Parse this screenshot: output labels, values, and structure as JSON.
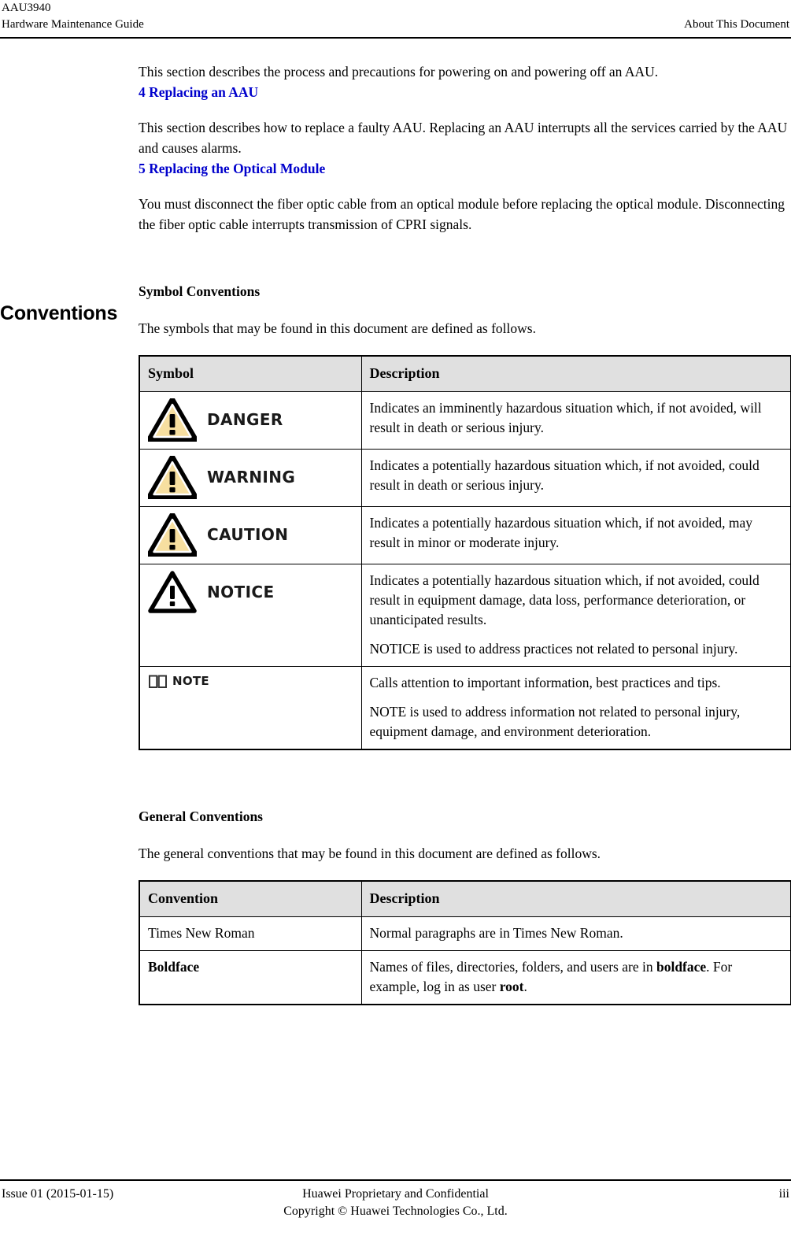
{
  "header": {
    "doc_id": "AAU3940",
    "guide_title": "Hardware Maintenance Guide",
    "section_name": "About This Document"
  },
  "body": {
    "intro_paragraph": "This section describes the process and precautions for powering on and powering off an AAU.",
    "links": [
      {
        "label": "4 Replacing an AAU",
        "description": "This section describes how to replace a faulty AAU. Replacing an AAU interrupts all the services carried by the AAU and causes alarms.",
        "color": "#0000CC"
      },
      {
        "label": "5 Replacing the Optical Module",
        "description": "You must disconnect the fiber optic cable from an optical module before replacing the optical module. Disconnecting the fiber optic cable interrupts transmission of CPRI signals.",
        "color": "#0000CC"
      }
    ],
    "conventions_heading": "Conventions",
    "symbol_conventions": {
      "heading": "Symbol Conventions",
      "intro": "The symbols that may be found in this document are defined as follows.",
      "columns": [
        "Symbol",
        "Description"
      ],
      "rows": [
        {
          "icon": "danger-triangle-icon",
          "icon_label": "DANGER",
          "icon_style": "filled-amber-triangle",
          "paragraphs": [
            "Indicates an imminently hazardous situation which, if not avoided, will result in death or serious injury."
          ]
        },
        {
          "icon": "warning-triangle-icon",
          "icon_label": "WARNING",
          "icon_style": "filled-amber-triangle",
          "paragraphs": [
            "Indicates a potentially hazardous situation which, if not avoided, could result in death or serious injury."
          ]
        },
        {
          "icon": "caution-triangle-icon",
          "icon_label": "CAUTION",
          "icon_style": "filled-amber-triangle",
          "paragraphs": [
            "Indicates a potentially hazardous situation which, if not avoided, may result in minor or moderate injury."
          ]
        },
        {
          "icon": "notice-triangle-icon",
          "icon_label": "NOTICE",
          "icon_style": "outline-triangle",
          "paragraphs": [
            "Indicates a potentially hazardous situation which, if not avoided, could result in equipment damage, data loss, performance deterioration, or unanticipated results.",
            "NOTICE is used to address practices not related to personal injury."
          ]
        },
        {
          "icon": "note-book-icon",
          "icon_label": "NOTE",
          "icon_style": "open-book",
          "paragraphs": [
            "Calls attention to important information, best practices and tips.",
            "NOTE is used to address information not related to personal injury, equipment damage, and environment deterioration."
          ]
        }
      ]
    },
    "general_conventions": {
      "heading": "General Conventions",
      "intro": "The general conventions that may be found in this document are defined as follows.",
      "columns": [
        "Convention",
        "Description"
      ],
      "rows": [
        {
          "convention": "Times New Roman",
          "convention_bold": false,
          "description_html": "Normal paragraphs are in Times New Roman."
        },
        {
          "convention": "Boldface",
          "convention_bold": true,
          "description_html": "Names of files, directories, folders, and users are in <b>boldface</b>. For example, log in as user <b>root</b>."
        }
      ]
    }
  },
  "footer": {
    "issue": "Issue 01 (2015-01-15)",
    "proprietary_line1": "Huawei Proprietary and Confidential",
    "proprietary_line2": "Copyright © Huawei Technologies Co., Ltd.",
    "page_number": "iii"
  },
  "colors": {
    "link": "#0000CC",
    "table_header_bg": "#E0E0E0",
    "triangle_fill": "#F7DFA0",
    "triangle_stroke": "#000000"
  }
}
